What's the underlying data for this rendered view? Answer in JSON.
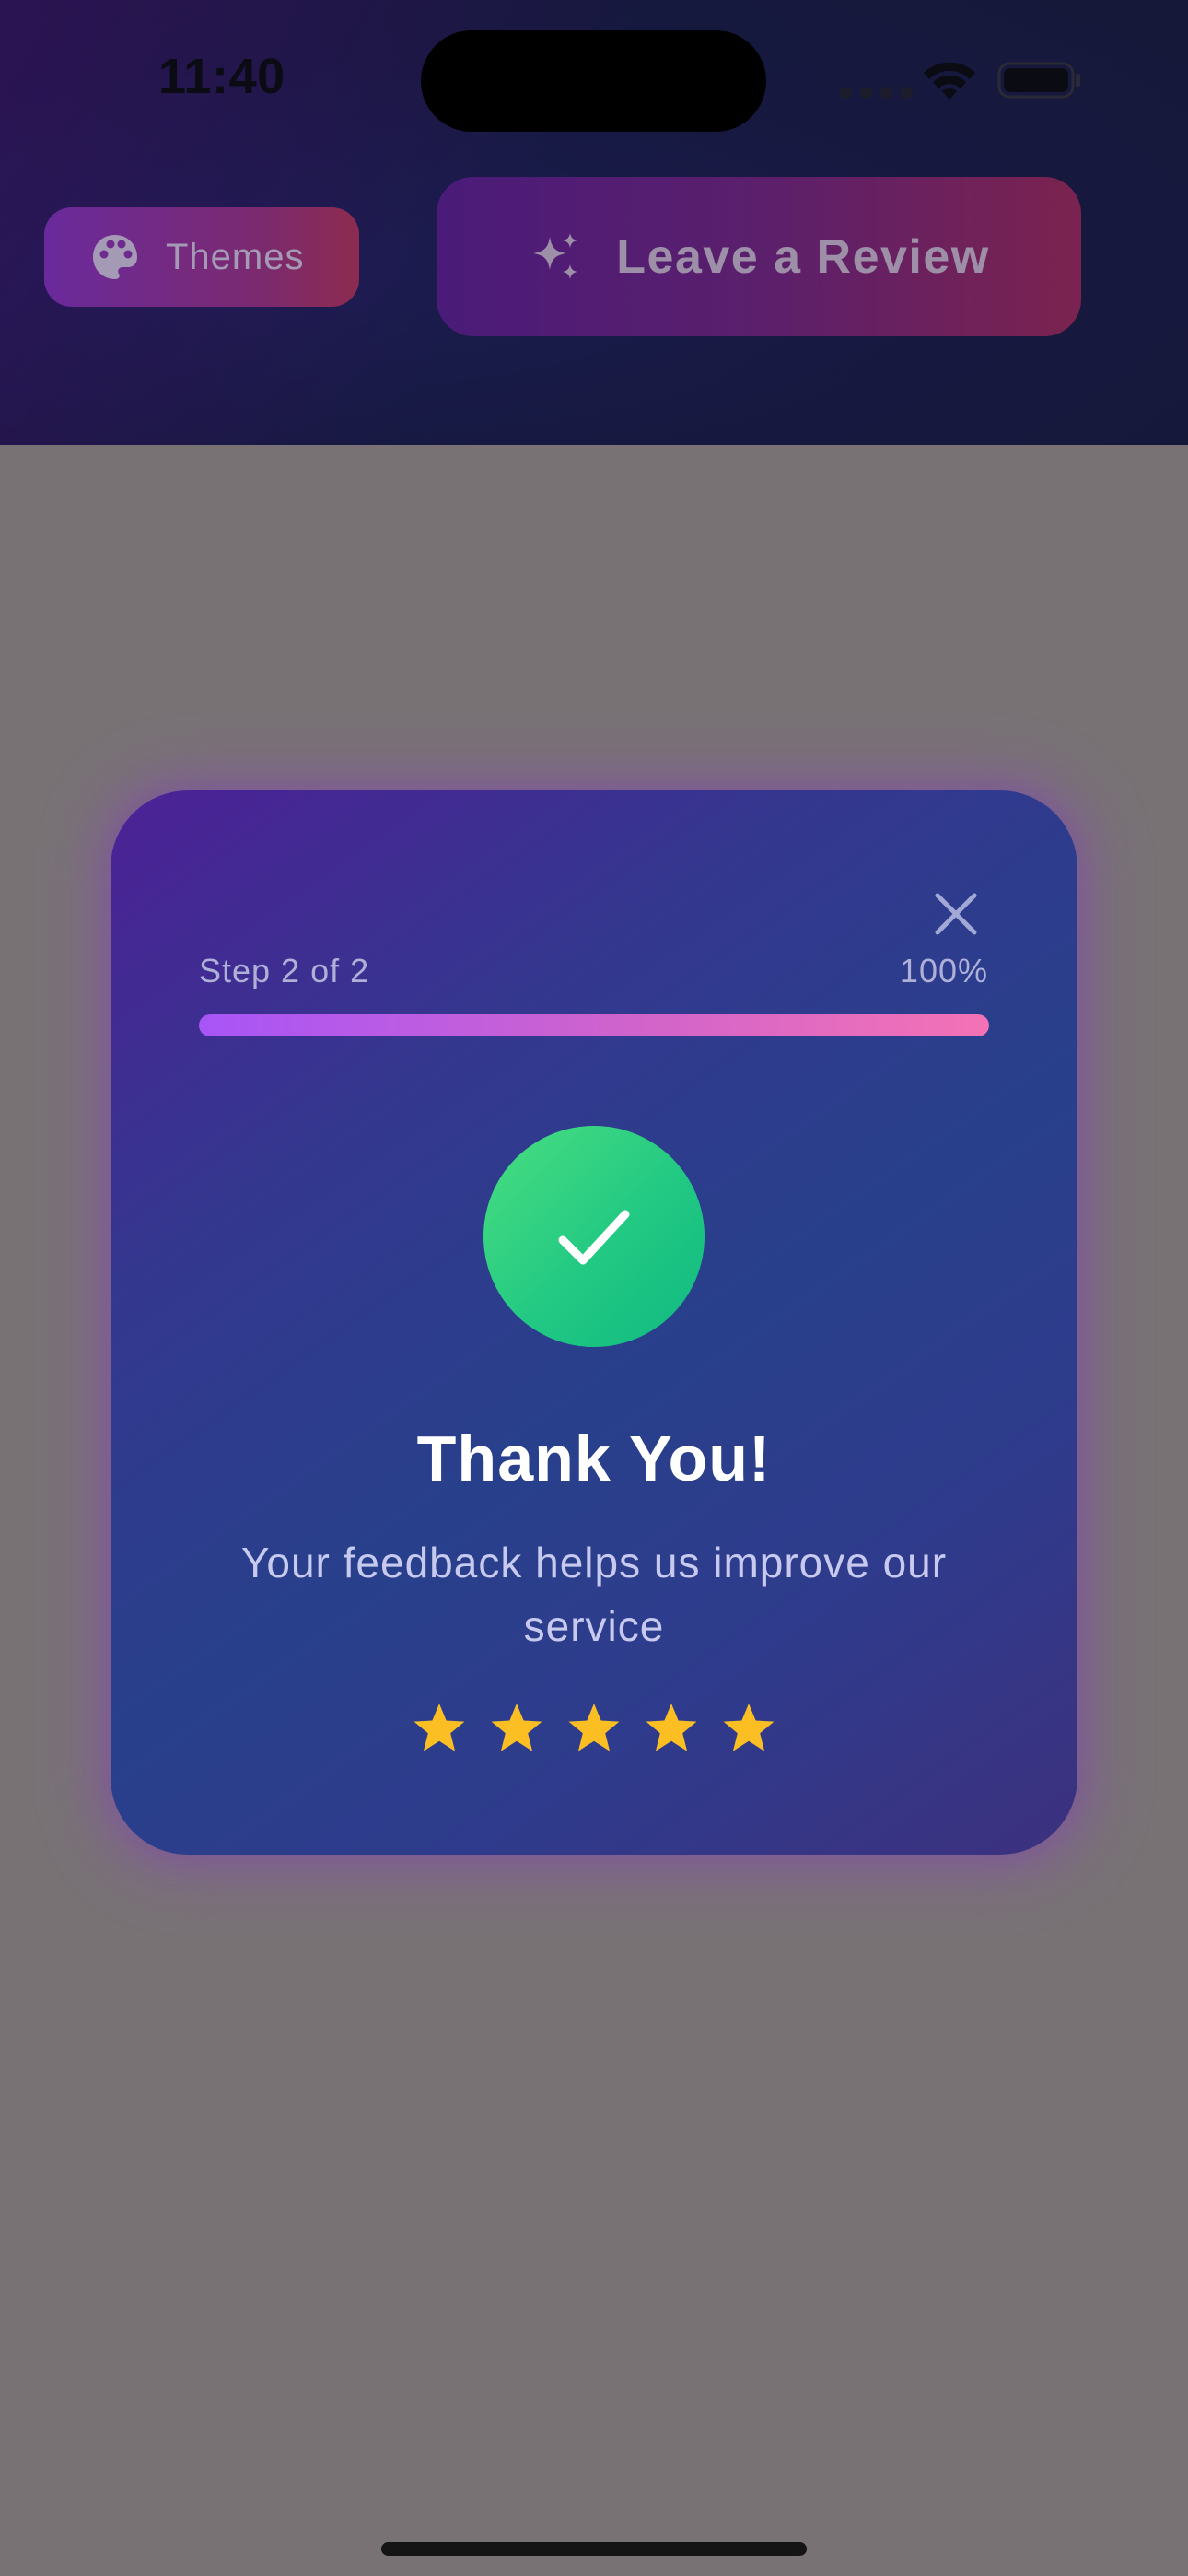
{
  "status_bar": {
    "time": "11:40",
    "icons": [
      "cellular-dots-icon",
      "wifi-icon",
      "battery-icon"
    ]
  },
  "header": {
    "themes_button": {
      "label": "Themes",
      "icon": "palette-icon"
    },
    "review_button": {
      "label": "Leave a Review",
      "icon": "sparkles-icon"
    }
  },
  "modal": {
    "close_icon": "close-icon",
    "step_label": "Step 2 of 2",
    "progress_label": "100%",
    "progress_fraction": 1.0,
    "success_icon": "checkmark-icon",
    "title": "Thank You!",
    "subtitle": "Your feedback helps us improve our service",
    "rating": 5,
    "rating_max": 5
  },
  "colors": {
    "overlay": "#787275",
    "header_bg": "#17183f",
    "accent_purple": "#a855f7",
    "accent_pink": "#f472b6",
    "success_green": "#22c983",
    "star_gold": "#fbbf24"
  }
}
